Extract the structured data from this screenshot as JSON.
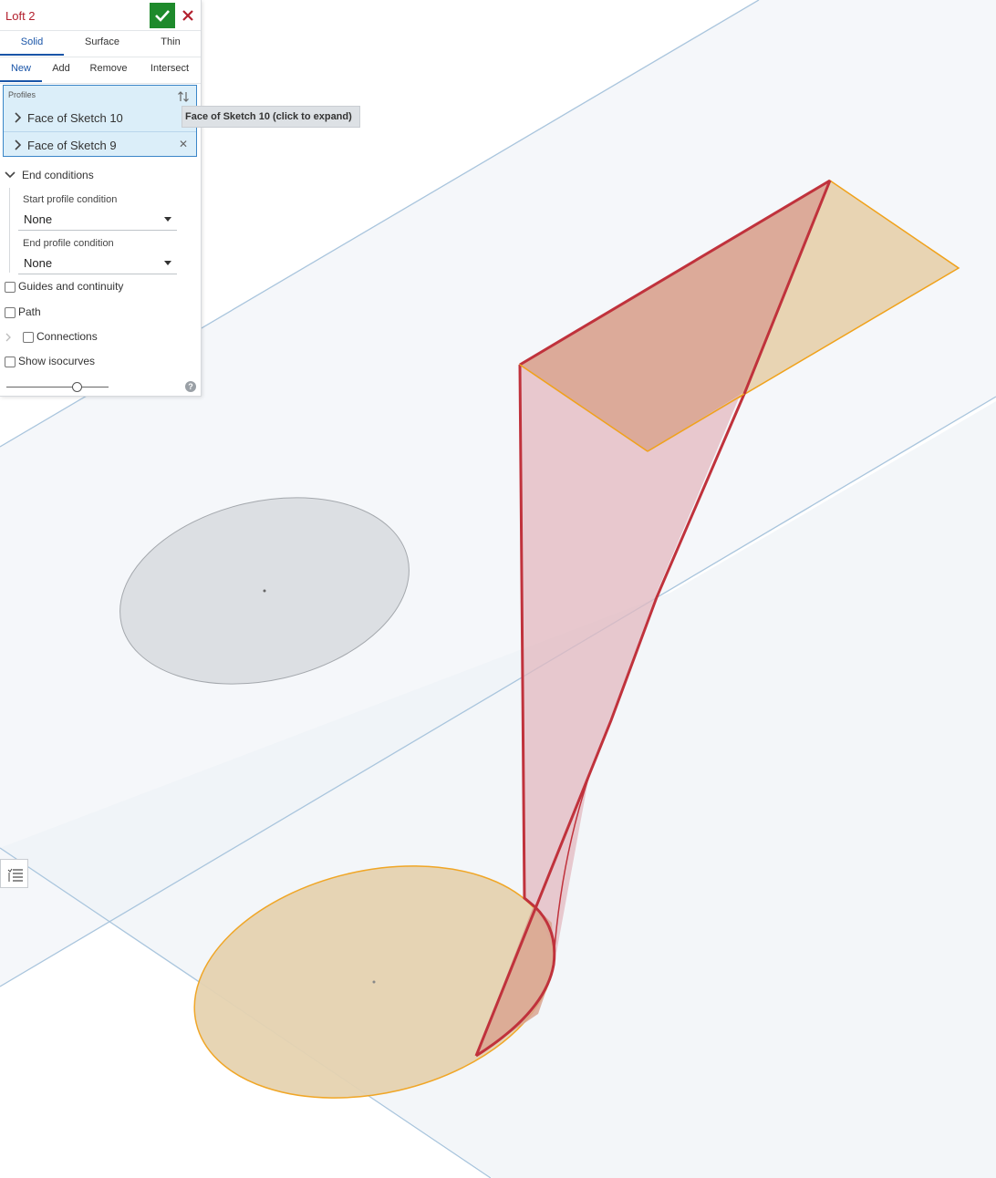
{
  "dialog": {
    "title": "Loft 2",
    "tabs_type": [
      {
        "label": "Solid",
        "active": true
      },
      {
        "label": "Surface",
        "active": false
      },
      {
        "label": "Thin",
        "active": false
      }
    ],
    "tabs_op": [
      {
        "label": "New",
        "active": true
      },
      {
        "label": "Add",
        "active": false
      },
      {
        "label": "Remove",
        "active": false
      },
      {
        "label": "Intersect",
        "active": false
      }
    ],
    "profiles": {
      "label": "Profiles",
      "items": [
        {
          "label": "Face of Sketch 10"
        },
        {
          "label": "Face of Sketch 9"
        }
      ]
    },
    "end_conditions": {
      "label": "End conditions",
      "start_label": "Start profile condition",
      "start_value": "None",
      "end_label": "End profile condition",
      "end_value": "None"
    },
    "guides": {
      "label": "Guides and continuity",
      "checked": false
    },
    "path": {
      "label": "Path",
      "checked": false
    },
    "connections": {
      "label": "Connections",
      "checked": false
    },
    "isocurves": {
      "label": "Show isocurves",
      "checked": false
    },
    "isocurve_slider_value": 0.7
  },
  "tooltip": {
    "text": "Face of Sketch 10 (click to expand)"
  },
  "colors": {
    "accent": "#1a55a8",
    "ok": "#1e8a2b",
    "cancel": "#b3202e",
    "profile_fill": "#e6d3b1",
    "profile_edge": "#f0a21b",
    "loft_edge": "#c0323c",
    "loft_fill": "#e3b8bf",
    "plane_edge": "#a9c5dd"
  }
}
